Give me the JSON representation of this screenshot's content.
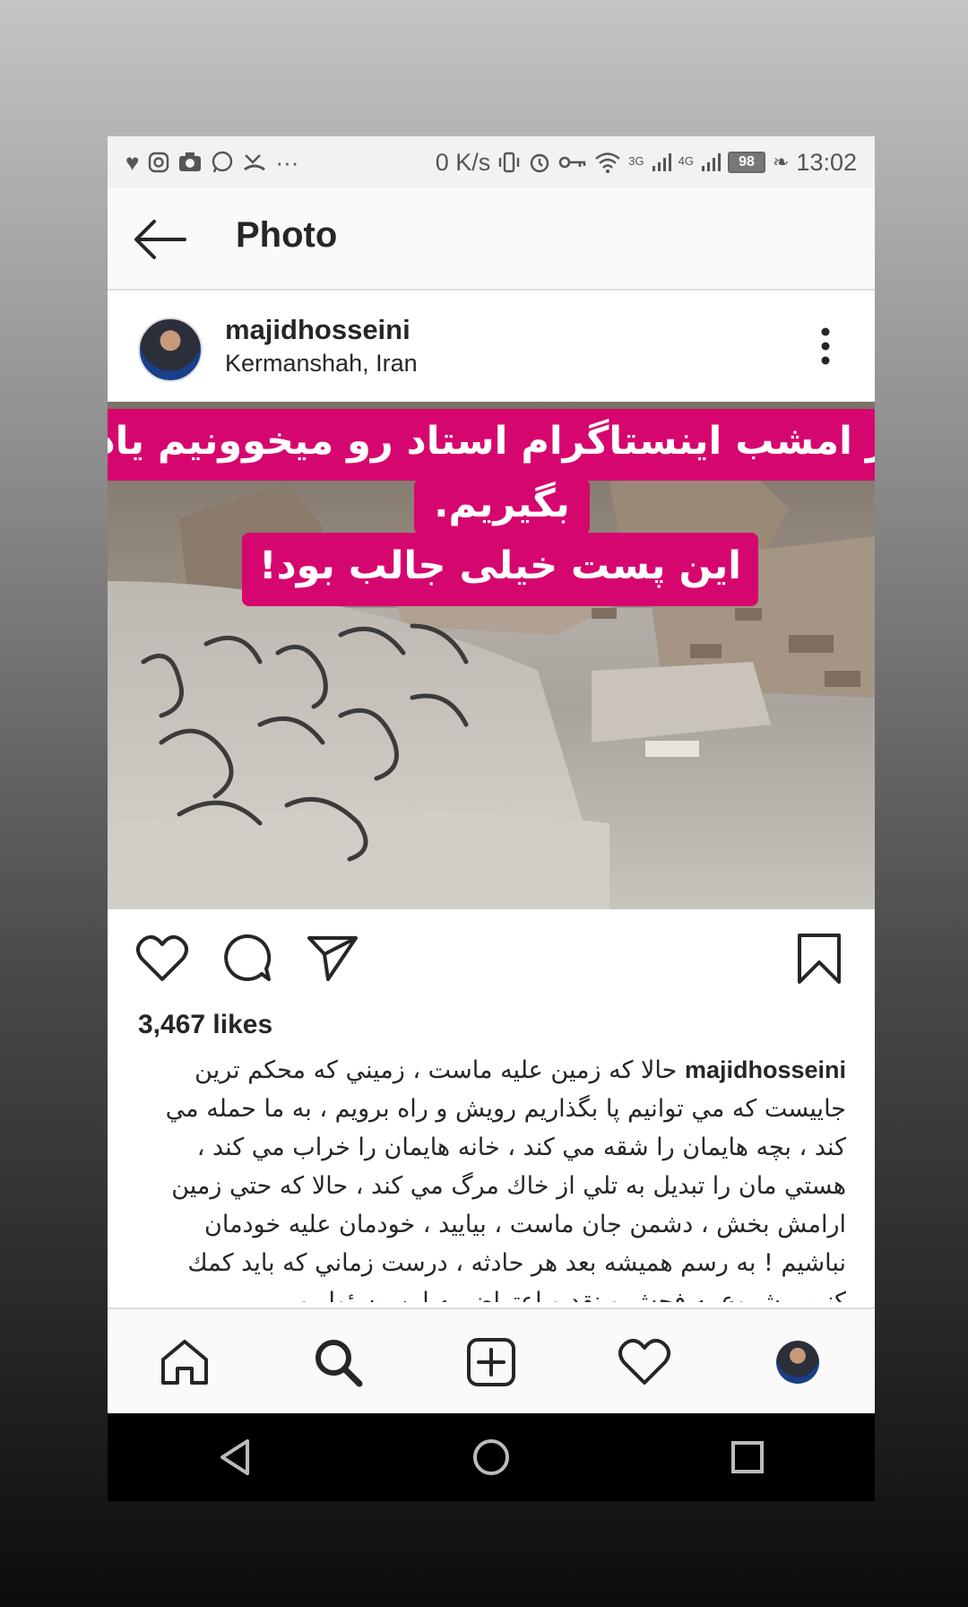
{
  "status_bar": {
    "left_icons": [
      "heart-pulse-icon",
      "instagram-icon",
      "camera-icon",
      "whatsapp-icon",
      "missed-call-icon"
    ],
    "more": "···",
    "speed": "0 K/s",
    "net_3g": "3G",
    "net_4g": "4G",
    "battery": "98",
    "time": "13:02"
  },
  "app_bar": {
    "title": "Photo"
  },
  "post": {
    "username": "majidhosseini",
    "location": "Kermanshah, Iran",
    "overlay_line1": "از امشب اینستاگرام استاد رو میخوونیم یاد",
    "overlay_line2": "بگیریم.",
    "overlay_line3": "این پست خیلی جالب بود!",
    "likes": "3,467 likes",
    "caption_user": "majidhosseini",
    "caption_text": "حالا كه زمين عليه ماست ، زميني كه محكم ترين جاييست كه مي توانيم پا بگذاريم رويش و راه برويم ، به ما حمله مي كند ، بچه هايمان را شقه مي كند ، خانه هايمان را خراب مي كند ، هستي مان را تبديل به تلي از خاك مرگ مي كند ، حالا كه حتي زمين ارامش بخش ، دشمن جان ماست ، بياييد ، خودمان عليه خودمان نباشيم ! به رسم هميشه بعد هر حادثه ، درست زماني كه بايد كمك كنيم ، شروع به فحش و نقد و اعتراض به اين مسئول و"
  },
  "colors": {
    "overlay_bg": "#d6066f",
    "text": "#262626"
  }
}
